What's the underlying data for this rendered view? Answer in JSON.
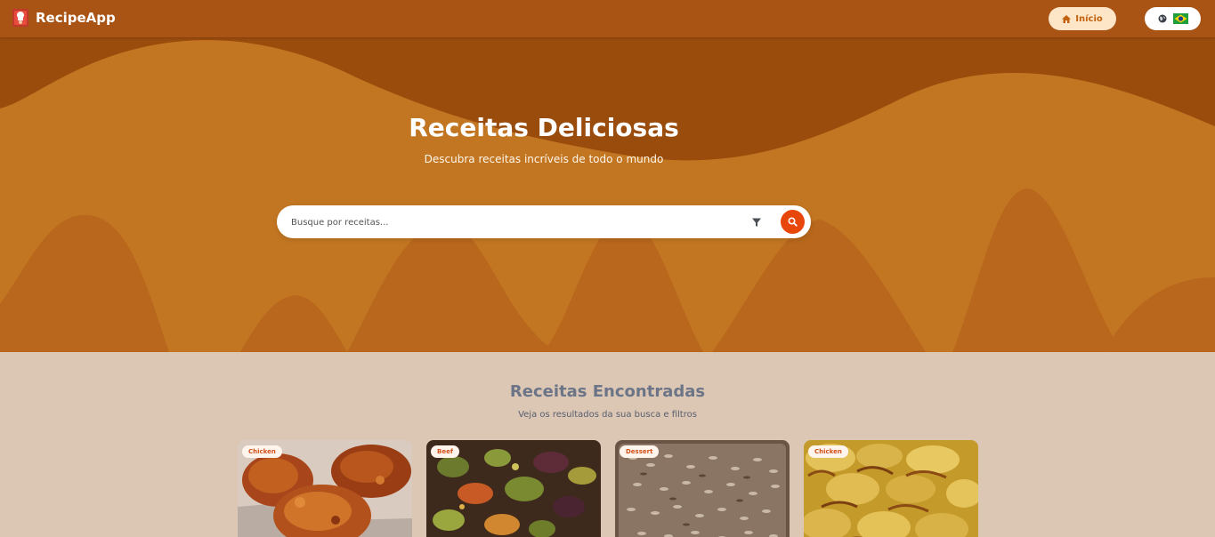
{
  "navbar": {
    "brand": "RecipeApp",
    "home_label": "Início",
    "language_flag": "brazil-flag-icon"
  },
  "hero": {
    "title": "Receitas Deliciosas",
    "subtitle": "Descubra receitas incríveis de todo o mundo"
  },
  "search": {
    "placeholder": "Busque por receitas...",
    "value": ""
  },
  "results": {
    "title": "Receitas Encontradas",
    "subtitle": "Veja os resultados da sua busca e filtros",
    "cards": [
      {
        "category": "Chicken"
      },
      {
        "category": "Beef"
      },
      {
        "category": "Dessert"
      },
      {
        "category": "Chicken"
      }
    ]
  },
  "colors": {
    "navbar": "#a95414",
    "hero": "#c37622",
    "accent": "#e8470c",
    "background": "#dcc6b4"
  }
}
